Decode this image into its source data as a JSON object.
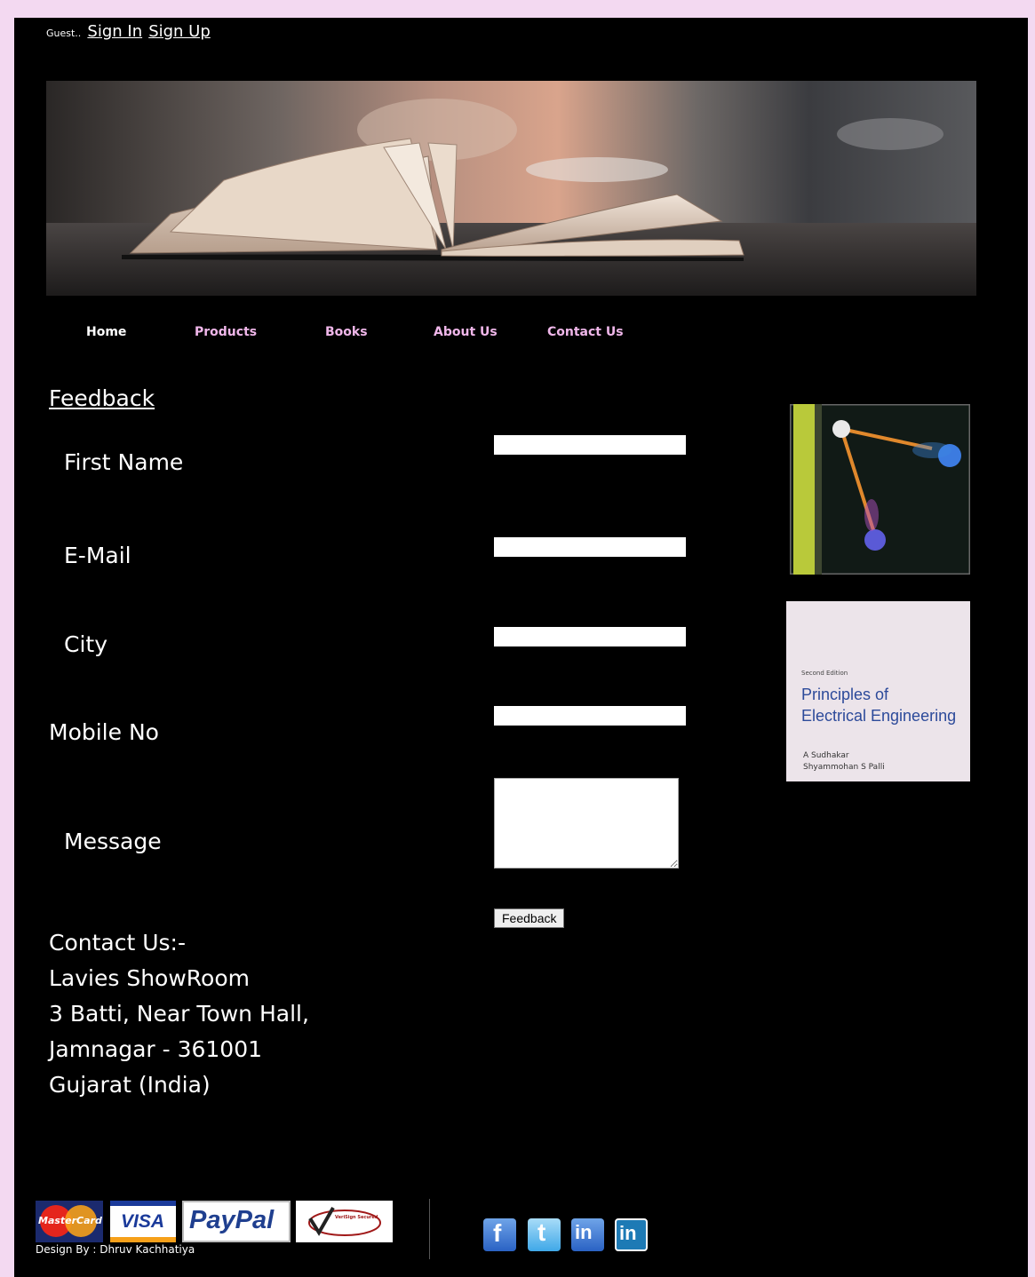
{
  "topbar": {
    "guest": "Guest..",
    "signin": "Sign In",
    "signup": "Sign Up"
  },
  "nav": {
    "items": [
      "Home",
      "Products",
      "Books",
      "About Us",
      "Contact Us"
    ]
  },
  "feedback_form": {
    "heading": "Feedback",
    "first_name_label": "First Name",
    "email_label": "E-Mail",
    "city_label": "City",
    "mobile_label": "Mobile No",
    "message_label": "Message",
    "submit_label": "Feedback"
  },
  "side_books": {
    "book2_edition": "Second Edition",
    "book2_title_line1": "Principles of",
    "book2_title_line2": "Electrical Engineering",
    "book2_author1": "A Sudhakar",
    "book2_author2": "Shyammohan S Palli"
  },
  "contact": {
    "lines": [
      "Contact Us:-",
      "Lavies ShowRoom",
      "3 Batti, Near Town Hall,",
      "Jamnagar - 361001",
      "Gujarat (India)"
    ]
  },
  "footer": {
    "design_by": "Design By : Dhruv Kachhatiya",
    "mastercard": "MasterCard",
    "visa": "VISA",
    "paypal": "PayPal",
    "verisign": "VeriSign Secured",
    "social": [
      "f",
      "t",
      "in",
      "in"
    ]
  },
  "colors": {
    "page_bg": "#f3d9f1",
    "content_bg": "#000000",
    "nav_link": "#f0b7ea"
  }
}
